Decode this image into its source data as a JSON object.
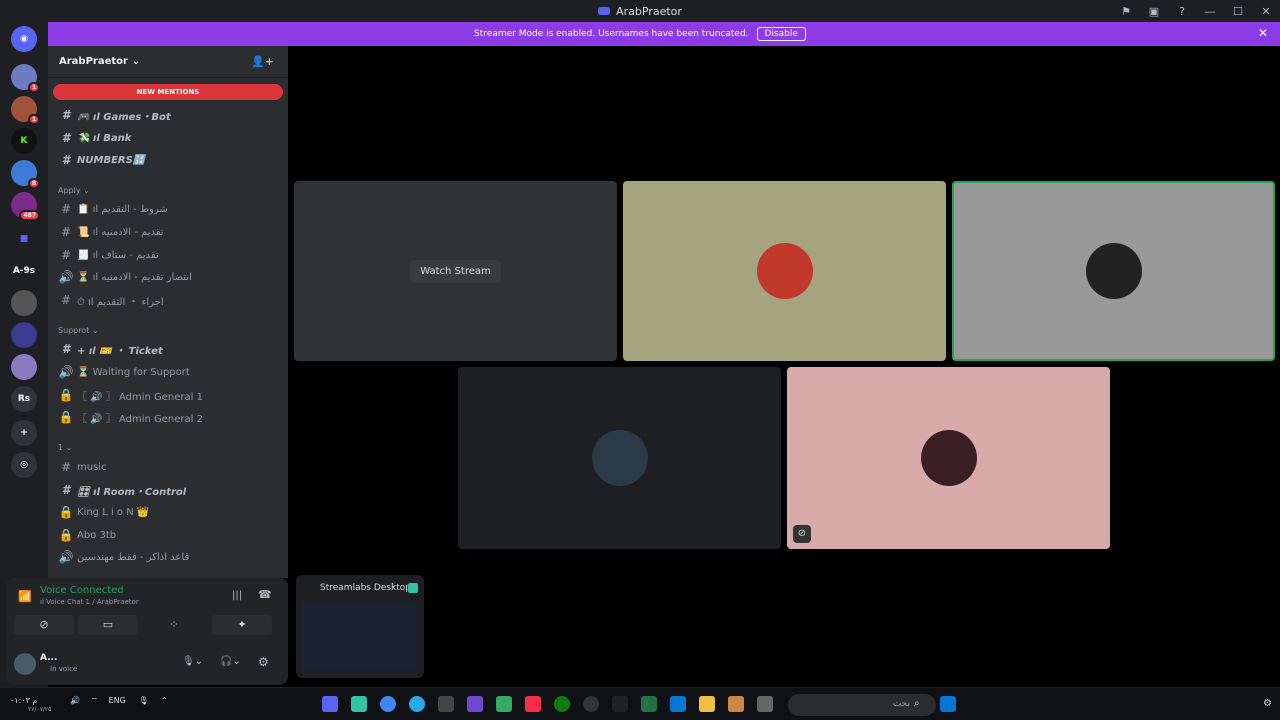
{
  "window": {
    "title": "ArabPraetor"
  },
  "banner": {
    "text": "Streamer Mode is enabled. Usernames have been truncated.",
    "disable_label": "Disable"
  },
  "server": {
    "name": "ArabPraetor"
  },
  "new_mentions": "NEW MENTIONS",
  "guild_badges": [
    "1",
    "1",
    "8",
    "487"
  ],
  "guild_labels": [
    "A-9s",
    "Rs"
  ],
  "channels": [
    {
      "icon": "#",
      "name": "🎮 ıl Games・Bot",
      "bold": true
    },
    {
      "icon": "#",
      "name": "💸 ıl Bank",
      "bold": true
    },
    {
      "icon": "#",
      "name": "NUMBERS🔢",
      "bold": true
    },
    {
      "icon": "#",
      "name": "📋 ıl شروط - التقديم"
    },
    {
      "icon": "#",
      "name": "📜 ıl تقديم - الادمنيه"
    },
    {
      "icon": "#",
      "name": "🧾 ıl تقديم - ستاف"
    },
    {
      "icon": "🔊",
      "name": "⏳ ıl انتضار تقديم - الادمنيه"
    },
    {
      "icon": "#",
      "name": "⏱ ıl اجراء ・ التقديم"
    },
    {
      "icon": "#",
      "name": "+ ıl 🎫 ・ Ticket",
      "bold": true
    },
    {
      "icon": "🔊",
      "name": "⏳ Waiting for Support"
    },
    {
      "icon": "🔒",
      "name": "〖 🔊 〗 Admin General 1"
    },
    {
      "icon": "🔒",
      "name": "〖 🔊 〗 Admin General 2"
    },
    {
      "icon": "#",
      "name": "music"
    },
    {
      "icon": "#",
      "name": "🎛 ıl Room・Control",
      "bold": true
    },
    {
      "icon": "🔒",
      "name": "King L i o N 👑"
    },
    {
      "icon": "🔒",
      "name": "Abo 3tb"
    },
    {
      "icon": "🔊",
      "name": "قاعد اذاكر - فقط مهندسين"
    }
  ],
  "categories": [
    "Apply",
    "Supprot",
    "1"
  ],
  "voice": {
    "status": "Voice Connected",
    "channel": "ıl Voice Chat 1 / ArabPraetor"
  },
  "user": {
    "name": "A...",
    "status": "In voice"
  },
  "stream_tile": {
    "watch_label": "Watch Stream"
  },
  "streamlabs": {
    "label": "Streamlabs Desktop"
  },
  "taskbar": {
    "language": "ENG",
    "search_placeholder": "بحث",
    "time": "م ٠١:٠٣",
    "date": "٢٧/٠٧/٢٥"
  },
  "colors": {
    "banner": "#8c3be6",
    "voice_green": "#23a55a",
    "mention_red": "#da373c"
  }
}
